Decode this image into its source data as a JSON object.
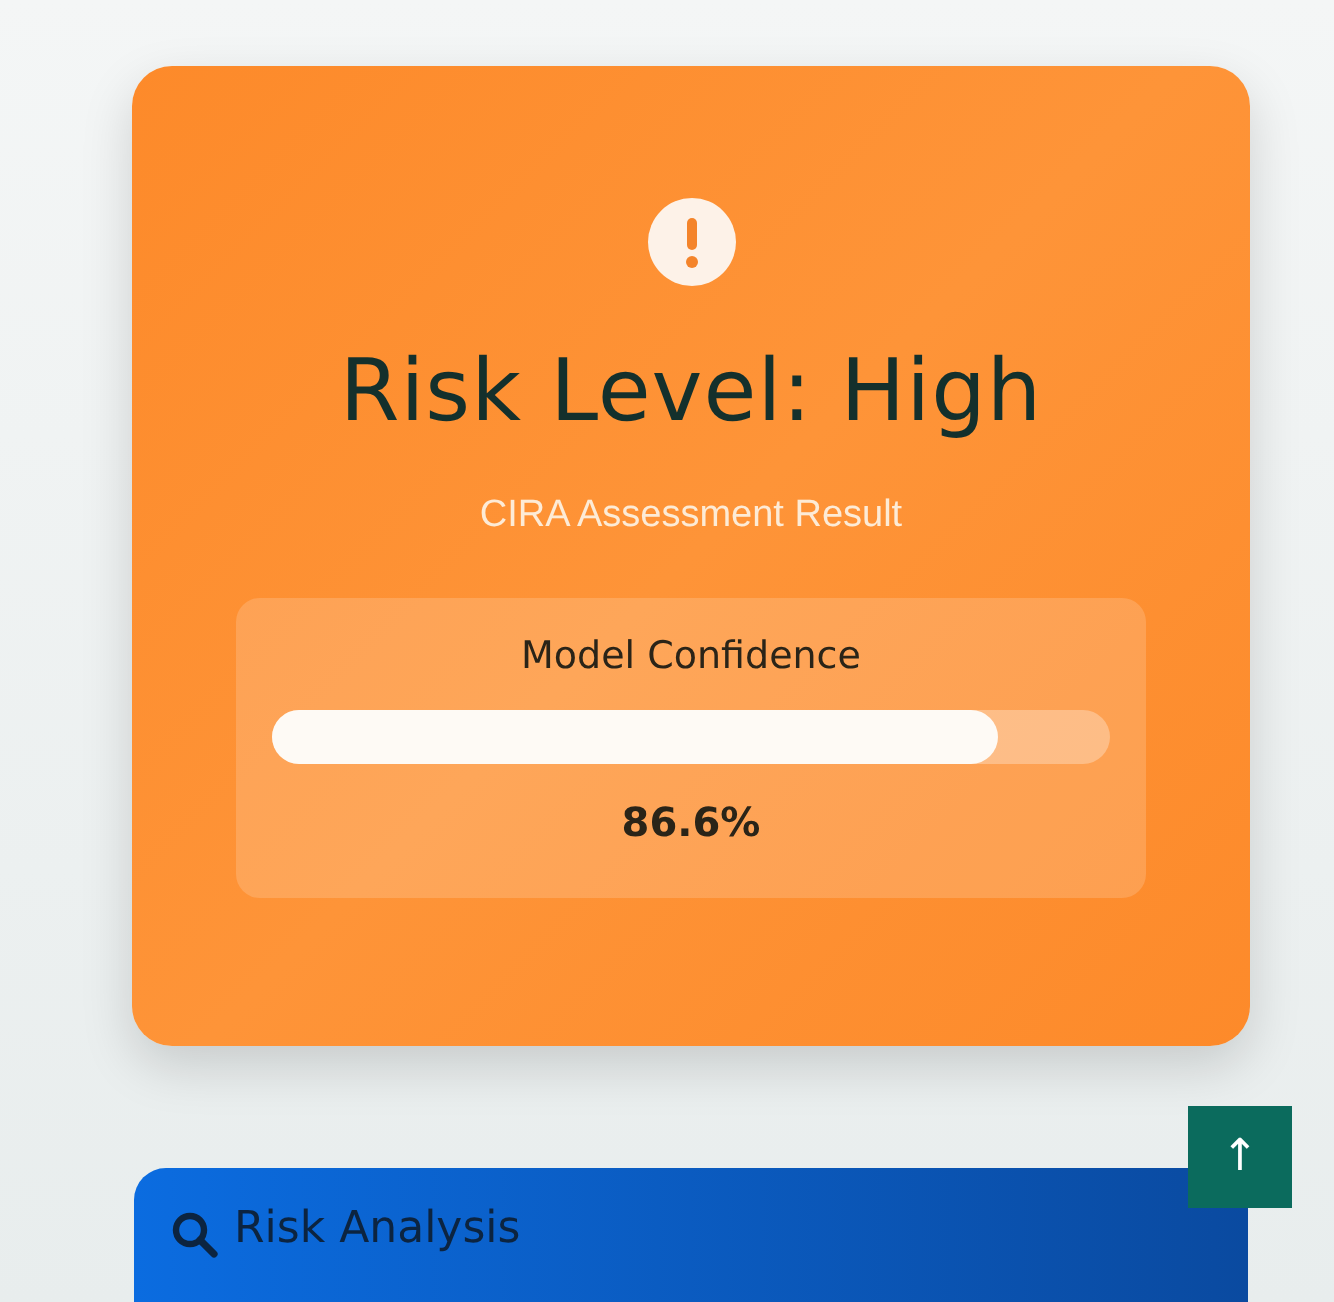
{
  "risk_card": {
    "title": "Risk Level: High",
    "subtitle": "CIRA Assessment Result",
    "confidence": {
      "label": "Model Confidence",
      "level": 0.866,
      "reading": "86.6%"
    }
  },
  "analysis_section": {
    "title": "Risk Analysis"
  },
  "back_to_top": {
    "label": "↑"
  }
}
